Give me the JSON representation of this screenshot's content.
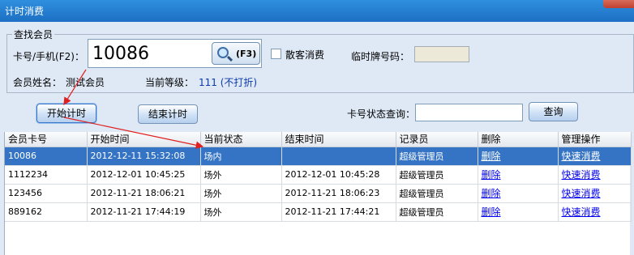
{
  "window": {
    "title": "计时消费"
  },
  "search_group": {
    "legend": "查找会员",
    "card_label": "卡号/手机(F2)：",
    "card_value": "10086",
    "search_key": "(F3)",
    "walkin_label": "散客消费",
    "temp_plate_label": "临时牌号码：",
    "member_name_label": "会员姓名：",
    "member_name_value": "测试会员",
    "level_label": "当前等级：",
    "level_value": "111 (不打折)"
  },
  "actions": {
    "start_label": "开始计时",
    "stop_label": "结束计时",
    "status_query_label": "卡号状态查询：",
    "query_label": "查询"
  },
  "table": {
    "columns": [
      "会员卡号",
      "开始时间",
      "当前状态",
      "结束时间",
      "记录员",
      "删除",
      "管理操作"
    ],
    "rows": [
      [
        "10086",
        "2012-12-11 15:32:08",
        "场内",
        "",
        "超级管理员",
        "删除",
        "快速消费"
      ],
      [
        "1112234",
        "2012-12-01 10:45:25",
        "场外",
        "2012-12-01 10:45:28",
        "超级管理员",
        "删除",
        "快速消费"
      ],
      [
        "123456",
        "2012-11-21 18:06:21",
        "场外",
        "2012-11-21 18:06:23",
        "超级管理员",
        "删除",
        "快速消费"
      ],
      [
        "889162",
        "2012-11-21 17:44:19",
        "场外",
        "2012-11-21 17:44:21",
        "超级管理员",
        "删除",
        "快速消费"
      ]
    ],
    "selected_row": 0
  },
  "colors": {
    "title_bar": "#1d6fc4",
    "selection": "#3574c4",
    "annotation_arrow": "#e02020",
    "link": "#0000ee"
  },
  "icons": {
    "search": "magnifier-icon",
    "close": "close-icon"
  }
}
